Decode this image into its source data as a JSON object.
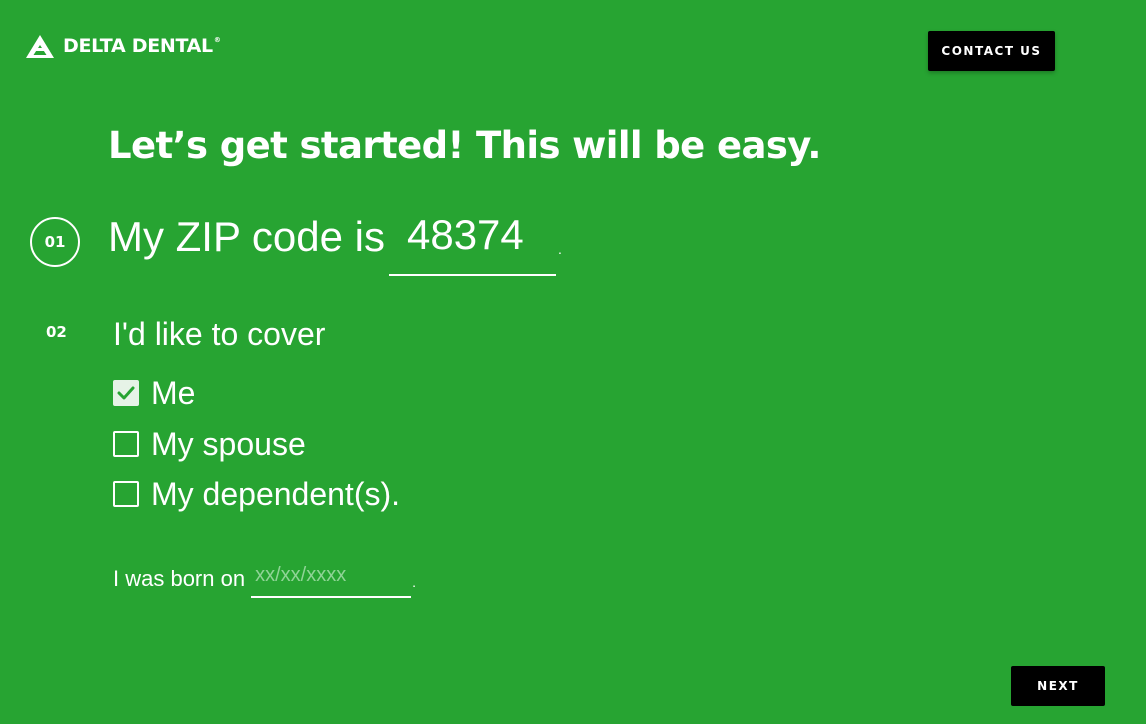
{
  "header": {
    "logo_text": "DELTA DENTAL",
    "logo_reg": "®",
    "logo_icon": "delta-triangle-icon",
    "contact_label": "CONTACT US"
  },
  "headline": "Let’s get started! This will be easy.",
  "steps": [
    {
      "number": "01",
      "label": "My ZIP code is",
      "zip_value": "48374",
      "suffix": "."
    },
    {
      "number": "02",
      "label": "I'd like to cover",
      "options": [
        {
          "label": "Me",
          "checked": true
        },
        {
          "label": "My spouse",
          "checked": false
        },
        {
          "label": "My dependent(s).",
          "checked": false
        }
      ]
    }
  ],
  "birth": {
    "label": "I was born on",
    "placeholder": "xx/xx/xxxx",
    "value": "",
    "suffix": "."
  },
  "footer": {
    "next_label": "NEXT"
  },
  "colors": {
    "background": "#27a432",
    "text": "#ffffff",
    "button": "#000000",
    "checkbox_checked": "#e6f3e7",
    "checkmark": "#27a432"
  }
}
